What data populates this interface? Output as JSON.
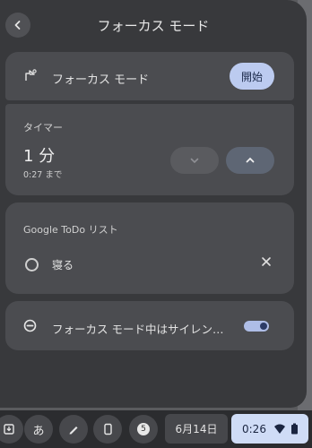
{
  "header": {
    "title": "フォーカス モード",
    "back_icon": "arrow-left-icon"
  },
  "focus": {
    "label": "フォーカス モード",
    "start_label": "開始",
    "icon": "focus-mode-icon"
  },
  "timer": {
    "title": "タイマー",
    "value": "1 分",
    "until": "0:27 まで",
    "down_icon": "chevron-down-icon",
    "up_icon": "chevron-up-icon"
  },
  "tasks": {
    "title": "Google ToDo リスト",
    "items": [
      {
        "label": "寝る"
      }
    ],
    "close_icon": "close-icon"
  },
  "silence": {
    "label": "フォーカス モード中はサイレン…",
    "icon": "do-not-disturb-icon",
    "toggle_on": true
  },
  "shelf": {
    "date": "6月14日",
    "time": "0:26",
    "ime": "あ",
    "notification_count": "5",
    "pods": [
      "download-tray-icon",
      "ime-icon",
      "stylus-icon",
      "phone-hub-icon",
      "notification-badge"
    ]
  },
  "colors": {
    "panel": "#38393c",
    "card": "#4b4c50",
    "accent": "#bccbf0"
  }
}
